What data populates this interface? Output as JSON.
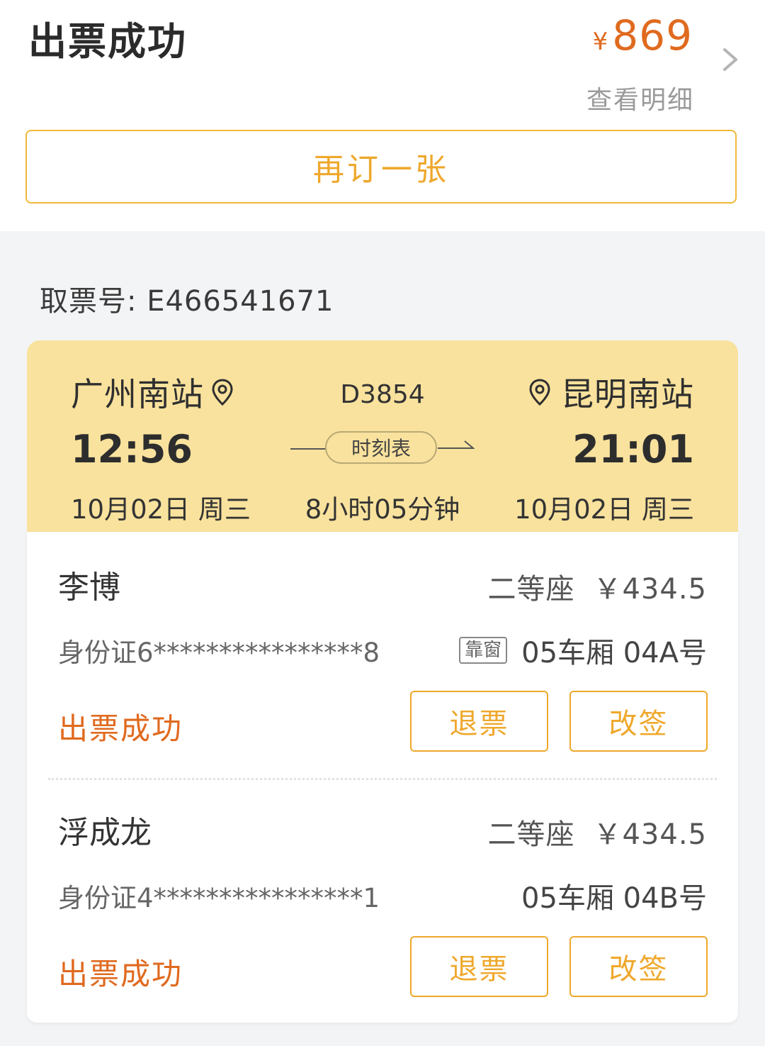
{
  "header": {
    "title": "出票成功",
    "currency_symbol": "¥",
    "total_price": "869",
    "detail_link": "查看明细"
  },
  "rebook_button": "再订一张",
  "pickup": "取票号: E466541671",
  "trip": {
    "from_station": "广州南站",
    "to_station": "昆明南站",
    "train_no": "D3854",
    "dep_time": "12:56",
    "arr_time": "21:01",
    "dep_date": "10月02日 周三",
    "arr_date": "10月02日 周三",
    "duration": "8小时05分钟",
    "schedule_label": "时刻表"
  },
  "passengers": [
    {
      "name": "李博",
      "seat_class": "二等座",
      "price": "￥434.5",
      "id": "身份证6****************8",
      "seat_tag": "靠窗",
      "seat": "05车厢 04A号",
      "status": "出票成功",
      "refund_label": "退票",
      "change_label": "改签"
    },
    {
      "name": "浮成龙",
      "seat_class": "二等座",
      "price": "￥434.5",
      "id": "身份证4****************1",
      "seat": "05车厢 04B号",
      "status": "出票成功",
      "refund_label": "退票",
      "change_label": "改签"
    }
  ],
  "colors": {
    "accent_orange": "#e06a1f",
    "button_gold": "#efa82c",
    "trip_card_bg": "#f9e29d"
  },
  "icons": [
    "chevron-right-icon",
    "location-pin-icon",
    "arrow-right-icon"
  ]
}
